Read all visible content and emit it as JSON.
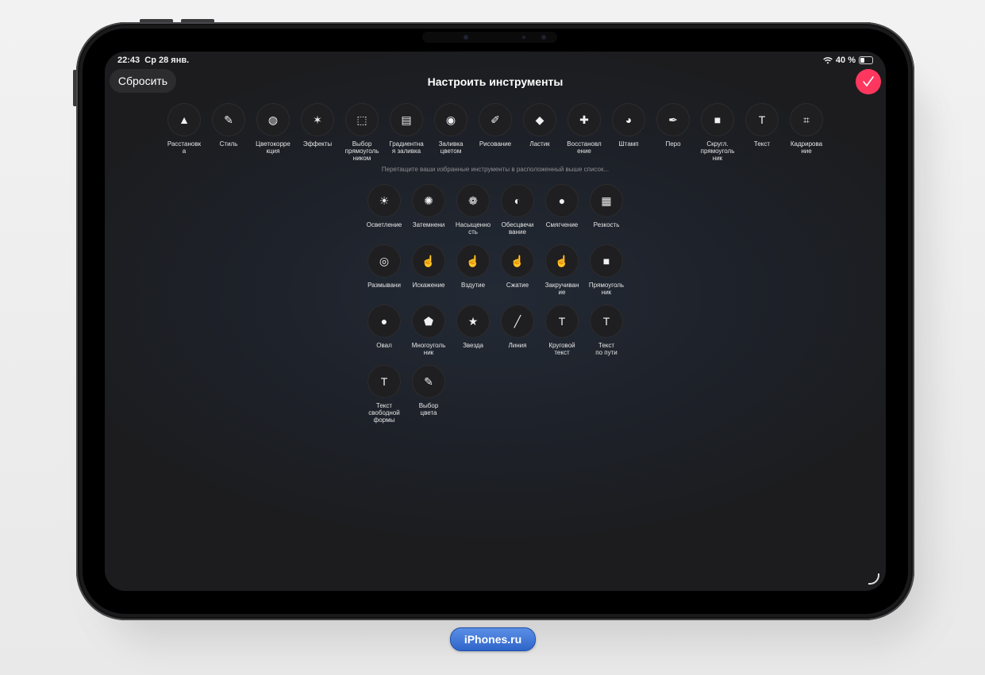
{
  "status_bar": {
    "time": "22:43",
    "date": "Ср 28 янв.",
    "battery": "40 %"
  },
  "header": {
    "reset_label": "Сбросить",
    "title": "Настроить инструменты",
    "done_icon": "checkmark"
  },
  "toolbar": [
    {
      "label": "Расстановк\nа",
      "icon": "▲"
    },
    {
      "label": "Стиль",
      "icon": "✎"
    },
    {
      "label": "Цветокорре\nкция",
      "icon": "◍"
    },
    {
      "label": "Эффекты",
      "icon": "✶"
    },
    {
      "label": "Выбор\nпрямоуголь\nником",
      "icon": "⬚"
    },
    {
      "label": "Градиентна\nя заливка",
      "icon": "▤"
    },
    {
      "label": "Заливка\nцветом",
      "icon": "◉"
    },
    {
      "label": "Рисование",
      "icon": "✐"
    },
    {
      "label": "Ластик",
      "icon": "◆"
    },
    {
      "label": "Восстановл\nение",
      "icon": "✚"
    },
    {
      "label": "Штамп",
      "icon": "◕"
    },
    {
      "label": "Перо",
      "icon": "✒"
    },
    {
      "label": "Скругл.\nпрямоуголь\nник",
      "icon": "■"
    },
    {
      "label": "Текст",
      "icon": "T"
    },
    {
      "label": "Кадрирова\nние",
      "icon": "⌗"
    }
  ],
  "hint": "Перетащите ваши избранные инструменты в расположенный выше список...",
  "available_tools": [
    {
      "label": "Осветление",
      "icon": "☀"
    },
    {
      "label": "Затемнени",
      "icon": "✺"
    },
    {
      "label": "Насыщенно\nсть",
      "icon": "❁"
    },
    {
      "label": "Обесцвечи\nвание",
      "icon": "◐"
    },
    {
      "label": "Смягчение",
      "icon": "●"
    },
    {
      "label": "Резкость",
      "icon": "▦"
    },
    {
      "label": "Размывани",
      "icon": "◎"
    },
    {
      "label": "Искажение",
      "icon": "☝"
    },
    {
      "label": "Вздутие",
      "icon": "☝"
    },
    {
      "label": "Сжатие",
      "icon": "☝"
    },
    {
      "label": "Закручиван\nие",
      "icon": "☝"
    },
    {
      "label": "Прямоуголь\nник",
      "icon": "■"
    },
    {
      "label": "Овал",
      "icon": "●"
    },
    {
      "label": "Многоуголь\nник",
      "icon": "⬟"
    },
    {
      "label": "Звезда",
      "icon": "★"
    },
    {
      "label": "Линия",
      "icon": "╱"
    },
    {
      "label": "Круговой\nтекст",
      "icon": "T"
    },
    {
      "label": "Текст\nпо пути",
      "icon": "T"
    },
    {
      "label": "Текст\nсвободной\nформы",
      "icon": "T"
    },
    {
      "label": "Выбор\nцвета",
      "icon": "✎"
    }
  ],
  "watermark": "iPhones.ru"
}
